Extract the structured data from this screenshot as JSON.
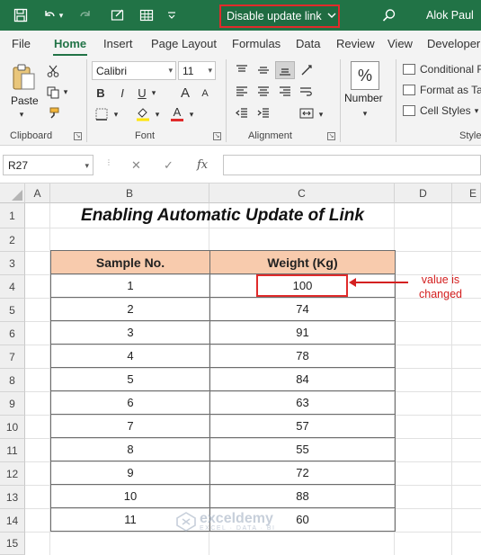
{
  "titlebar": {
    "document_name": "Disable update link",
    "user": "Alok Paul"
  },
  "tabs": [
    "File",
    "Home",
    "Insert",
    "Page Layout",
    "Formulas",
    "Data",
    "Review",
    "View",
    "Developer"
  ],
  "active_tab": "Home",
  "ribbon": {
    "clipboard": {
      "paste_label": "Paste",
      "group_label": "Clipboard"
    },
    "font": {
      "font_name": "Calibri",
      "font_size": "11",
      "group_label": "Font",
      "bold": "B",
      "italic": "I",
      "underline": "U",
      "grow": "A",
      "shrink": "A"
    },
    "alignment": {
      "group_label": "Alignment"
    },
    "number": {
      "label": "Number",
      "symbol": "%"
    },
    "styles": {
      "conditional": "Conditional F",
      "format_as_table": "Format as Ta",
      "cell_styles": "Cell Styles",
      "group_label": "Style"
    }
  },
  "formula_bar": {
    "name_box": "R27",
    "fx": "fx",
    "cancel": "✕",
    "enter": "✓",
    "value": ""
  },
  "columns": [
    "A",
    "B",
    "C",
    "D",
    "E"
  ],
  "rows": [
    "1",
    "2",
    "3",
    "4",
    "5",
    "6",
    "7",
    "8",
    "9",
    "10",
    "11",
    "12",
    "13",
    "14",
    "15"
  ],
  "sheet": {
    "title": "Enabling Automatic Update of Link",
    "headers": [
      "Sample No.",
      "Weight (Kg)"
    ],
    "data": [
      [
        "1",
        "100"
      ],
      [
        "2",
        "74"
      ],
      [
        "3",
        "91"
      ],
      [
        "4",
        "78"
      ],
      [
        "5",
        "84"
      ],
      [
        "6",
        "63"
      ],
      [
        "7",
        "57"
      ],
      [
        "8",
        "55"
      ],
      [
        "9",
        "72"
      ],
      [
        "10",
        "88"
      ],
      [
        "11",
        "60"
      ]
    ]
  },
  "annotation": {
    "line1": "value is",
    "line2": "changed",
    "color": "#d42020"
  },
  "watermark": {
    "name": "exceldemy",
    "tagline": "EXCEL · DATA · BI"
  },
  "colors": {
    "excel_green": "#217346",
    "header_fill": "#f8cbad",
    "highlight_red": "#e02b2b"
  }
}
